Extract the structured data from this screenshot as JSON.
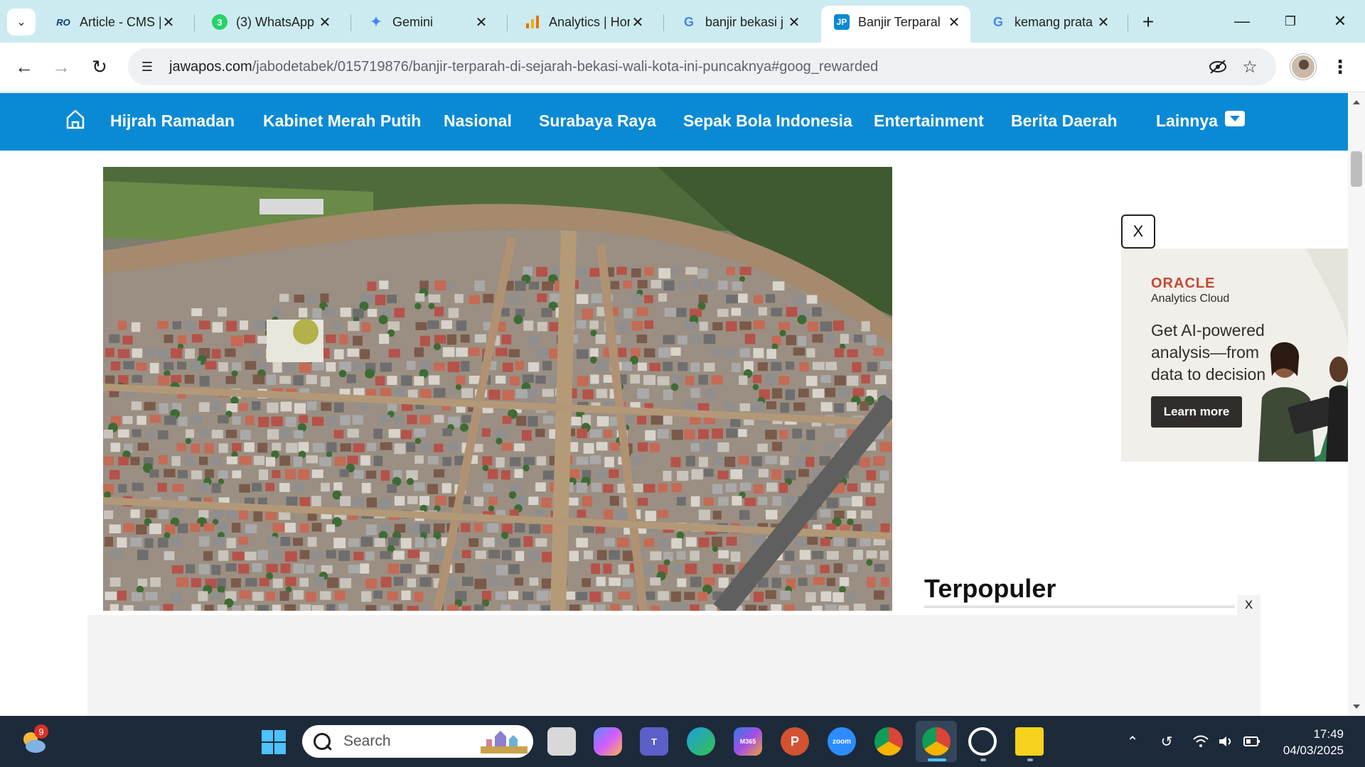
{
  "tabs": [
    {
      "title": "Article - CMS |",
      "favicon": "RO"
    },
    {
      "title": "(3) WhatsApp",
      "favicon": "3"
    },
    {
      "title": "Gemini",
      "favicon": "✦"
    },
    {
      "title": "Analytics | Hor",
      "favicon": "▮"
    },
    {
      "title": "banjir bekasi j",
      "favicon": "G"
    },
    {
      "title": "Banjir Terparal",
      "favicon": "JP",
      "active": true
    },
    {
      "title": "kemang prata",
      "favicon": "G"
    }
  ],
  "address_bar": {
    "domain": "jawapos.com",
    "path": "/jabodetabek/015719876/banjir-terparah-di-sejarah-bekasi-wali-kota-ini-puncaknya#goog_rewarded"
  },
  "site_nav": {
    "items": [
      "Hijrah Ramadan",
      "Kabinet Merah Putih",
      "Nasional",
      "Surabaya Raya",
      "Sepak Bola Indonesia",
      "Entertainment",
      "Berita Daerah",
      "Lainnya"
    ],
    "brand_color": "#0a8ad5"
  },
  "ad": {
    "close_label": "X",
    "brand": "ORACLE",
    "sub": "Analytics Cloud",
    "headline": "Get AI-powered analysis—from data to decision",
    "cta": "Learn more"
  },
  "sidebar": {
    "heading": "Terpopuler"
  },
  "bottom_ad": {
    "close_label": "X"
  },
  "taskbar": {
    "notification_count": "9",
    "search_placeholder": "Search",
    "apps": [
      "File Explorer",
      "Copilot",
      "Teams",
      "Edge",
      "Microsoft 365",
      "PowerPoint",
      "Zoom",
      "Chrome",
      "Chrome Profile",
      "Opera",
      "Sticky Notes"
    ],
    "time": "17:49",
    "date": "04/03/2025"
  }
}
